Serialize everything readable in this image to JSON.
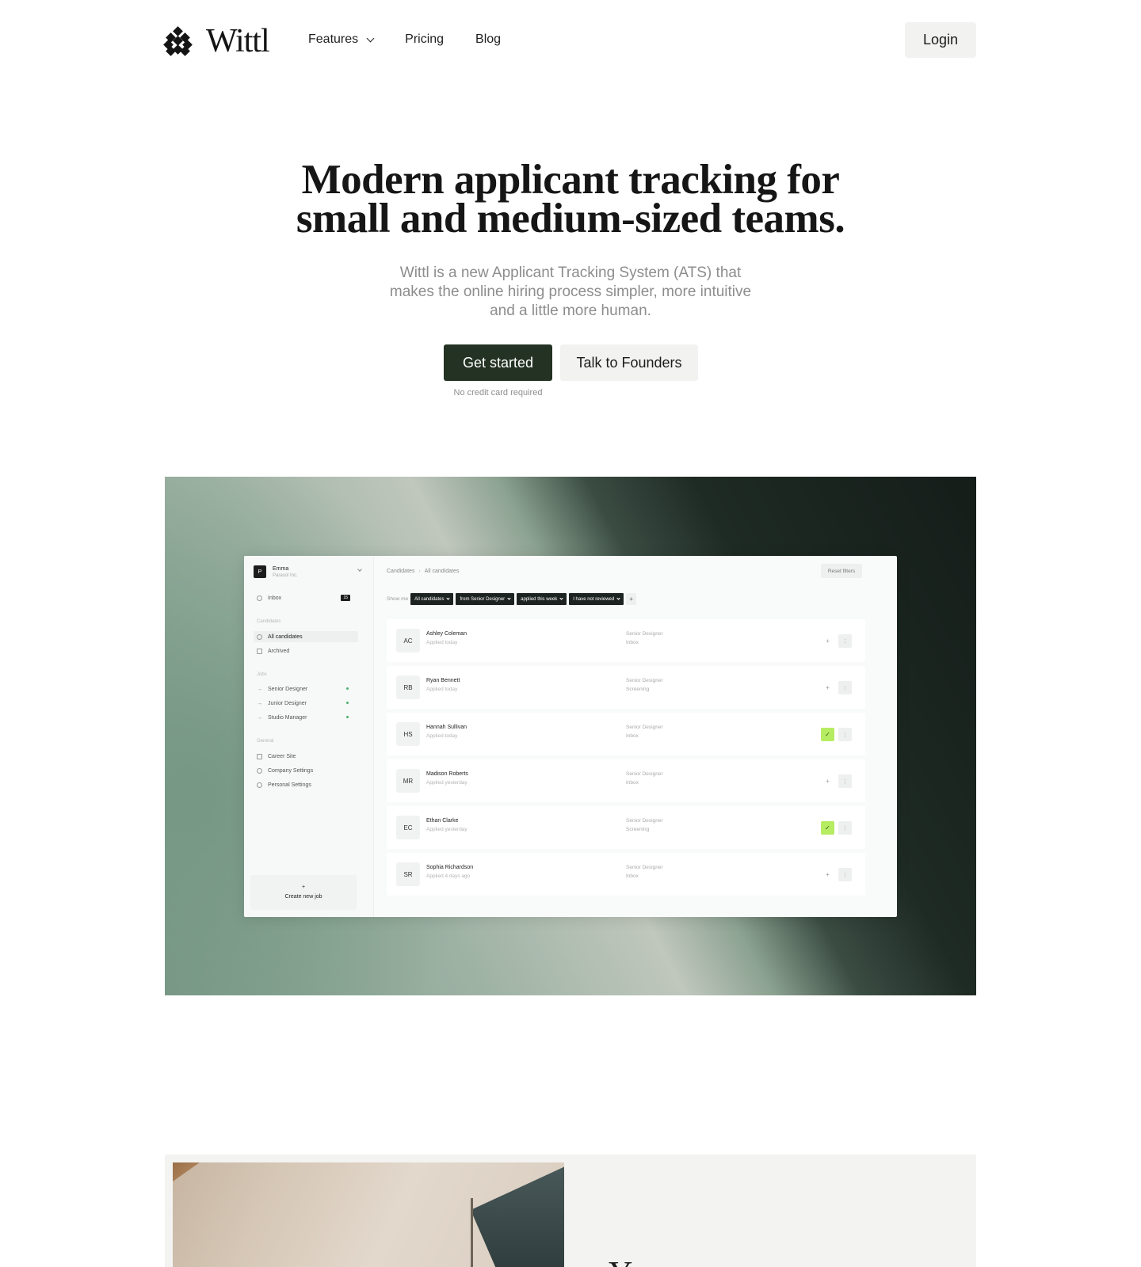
{
  "brand": {
    "name": "Wittl"
  },
  "nav": {
    "links": [
      {
        "label": "Features",
        "has_dropdown": true
      },
      {
        "label": "Pricing"
      },
      {
        "label": "Blog"
      }
    ],
    "login_label": "Login"
  },
  "hero": {
    "title_line1": "Modern applicant tracking for",
    "title_line2": "small and medium-sized teams.",
    "subtitle": "Wittl is a new Applicant Tracking System (ATS) that makes the online hiring process simpler, more intuitive and a little more human.",
    "primary_cta": "Get started",
    "secondary_cta": "Talk to Founders",
    "note": "No credit card required"
  },
  "app_preview": {
    "workspace": {
      "initial": "P",
      "user": "Emma",
      "company": "Parasol Inc."
    },
    "inbox": {
      "label": "Inbox",
      "count": "15"
    },
    "candidates_heading": "Candidates",
    "candidate_links": [
      "All candidates",
      "Archived"
    ],
    "jobs_heading": "Jobs",
    "jobs": [
      "Senior Designer",
      "Junior Designer",
      "Studio Manager"
    ],
    "general_heading": "General",
    "general_links": [
      "Career Site",
      "Company Settings",
      "Personal Settings"
    ],
    "create_job": {
      "icon": "+",
      "label": "Create new job"
    },
    "breadcrumb": [
      "Candidates",
      "All candidates"
    ],
    "reset_filters": "Reset filters",
    "filter_label": "Show me",
    "filters": [
      "All candidates",
      "from Senior Designer",
      "applied this week",
      "I have not reviewed"
    ],
    "filter_add": "+",
    "candidates": [
      {
        "initials": "AC",
        "name": "Ashley Coleman",
        "applied": "Applied today",
        "role": "Senior Designer",
        "stage": "Inbox",
        "action": "+",
        "reviewed": false
      },
      {
        "initials": "RB",
        "name": "Ryan Bennett",
        "applied": "Applied today",
        "role": "Senior Designer",
        "stage": "Screening",
        "action": "+",
        "reviewed": false
      },
      {
        "initials": "HS",
        "name": "Hannah Sullivan",
        "applied": "Applied today",
        "role": "Senior Designer",
        "stage": "Inbox",
        "action": "✓",
        "reviewed": true
      },
      {
        "initials": "MR",
        "name": "Madison Roberts",
        "applied": "Applied yesterday",
        "role": "Senior Designer",
        "stage": "Inbox",
        "action": "+",
        "reviewed": false
      },
      {
        "initials": "EC",
        "name": "Ethan Clarke",
        "applied": "Applied yesterday",
        "role": "Senior Designer",
        "stage": "Screening",
        "action": "✓",
        "reviewed": true
      },
      {
        "initials": "SR",
        "name": "Sophia Richardson",
        "applied": "Applied 4 days ago",
        "role": "Senior Designer",
        "stage": "Inbox",
        "action": "+",
        "reviewed": false
      }
    ],
    "more_glyph": "⋮"
  },
  "feature": {
    "heading_partial": "Y"
  },
  "colors": {
    "primary_button": "#233223",
    "accent_check": "#b6ec62",
    "job_dot": "#4bb36d"
  }
}
